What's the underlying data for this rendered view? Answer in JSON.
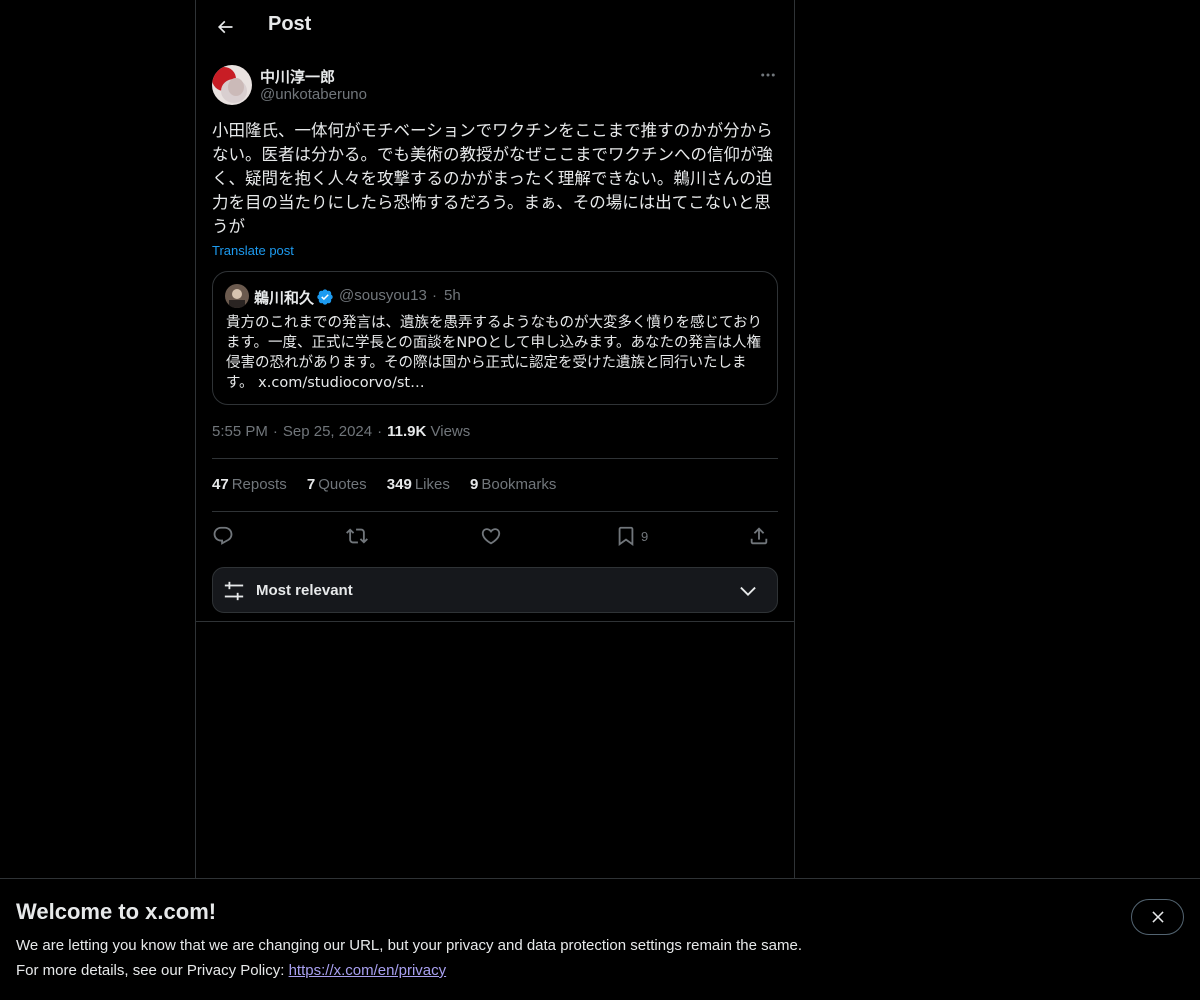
{
  "header": {
    "title": "Post"
  },
  "post": {
    "author_name": "中川淳一郎",
    "author_handle": "@unkotaberuno",
    "text": "小田隆氏、一体何がモチベーションでワクチンをここまで推すのかが分からない。医者は分かる。でも美術の教授がなぜここまでワクチンへの信仰が強く、疑問を抱く人々を攻撃するのかがまったく理解できない。鵜川さんの迫力を目の当たりにしたら恐怖するだろう。まぁ、その場には出てこないと思うが",
    "translate_label": "Translate post",
    "time": "5:55 PM",
    "date": "Sep 25, 2024",
    "views_count": "11.9K",
    "views_label": "Views"
  },
  "quote": {
    "name": "鵜川和久",
    "handle": "@sousyou13",
    "separator": "·",
    "time": "5h",
    "text": "貴方のこれまでの発言は、遺族を愚弄するようなものが大変多く憤りを感じております。一度、正式に学長との面談をNPOとして申し込みます。あなたの発言は人権侵害の恐れがあります。その際は国から正式に認定を受けた遺族と同行いたします。 x.com/studiocorvo/st…"
  },
  "stats": {
    "reposts": {
      "n": "47",
      "label": "Reposts"
    },
    "quotes": {
      "n": "7",
      "label": "Quotes"
    },
    "likes": {
      "n": "349",
      "label": "Likes"
    },
    "bookmarks": {
      "n": "9",
      "label": "Bookmarks"
    }
  },
  "actions": {
    "bookmark_count": "9",
    "icons": [
      "reply-icon",
      "repost-icon",
      "like-icon",
      "bookmark-icon",
      "share-icon"
    ]
  },
  "sort": {
    "label": "Most relevant"
  },
  "banner": {
    "title": "Welcome to x.com!",
    "line1": "We are letting you know that we are changing our URL, but your privacy and data protection settings remain the same.",
    "line2_prefix": "For more details, see our Privacy Policy: ",
    "link": "https://x.com/en/privacy"
  },
  "colors": {
    "background": "#000000",
    "text": "#e7e9ea",
    "muted": "#71767b",
    "accent": "#1d9bf0",
    "border": "#2f3336",
    "link": "#a8a0f0"
  }
}
